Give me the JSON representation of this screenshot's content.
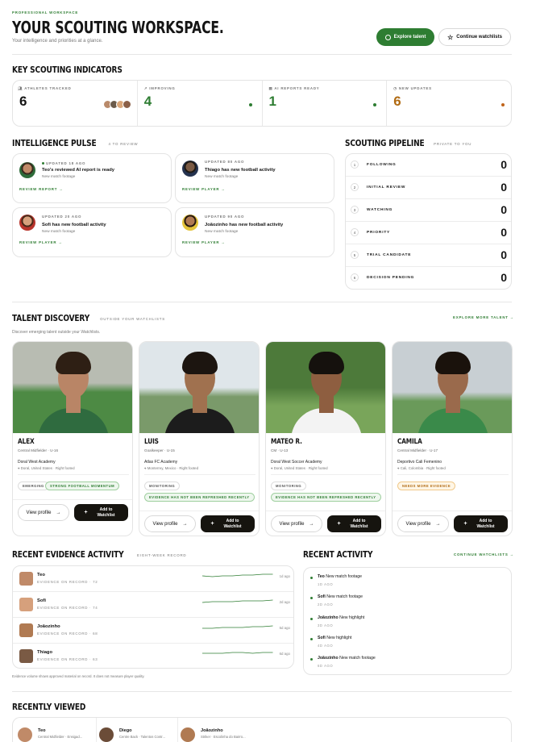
{
  "header": {
    "eyebrow": "PROFESSIONAL WORKSPACE",
    "title": "YOUR SCOUTING WORKSPACE.",
    "subtitle": "Your intelligence and priorities at a glance.",
    "explore_label": "Explore talent",
    "continue_label": "Continue watchlists"
  },
  "kpi": {
    "title": "KEY SCOUTING INDICATORS",
    "items": [
      {
        "label": "ATHLETES TRACKED",
        "value": "6"
      },
      {
        "label": "IMPROVING",
        "value": "4"
      },
      {
        "label": "AI REPORTS READY",
        "value": "1"
      },
      {
        "label": "NEW UPDATES",
        "value": "6"
      }
    ]
  },
  "pulse": {
    "title": "INTELLIGENCE PULSE",
    "badge": "4 TO REVIEW",
    "cards": [
      {
        "time": "UPDATED 18 AGO",
        "headline": "Teo's reviewed AI report is ready",
        "sub": "New match footage",
        "action": "REVIEW REPORT →"
      },
      {
        "time": "UPDATED 80 AGO",
        "headline": "Thiago has new football activity",
        "sub": "New match footage",
        "action": "REVIEW PLAYER →"
      },
      {
        "time": "UPDATED 20 AGO",
        "headline": "Sofi has new football activity",
        "sub": "New match footage",
        "action": "REVIEW PLAYER →"
      },
      {
        "time": "UPDATED 90 AGO",
        "headline": "Joãozinho has new football activity",
        "sub": "New match footage",
        "action": "REVIEW PLAYER →"
      }
    ]
  },
  "pipeline": {
    "title": "SCOUTING PIPELINE",
    "badge": "PRIVATE TO YOU",
    "stages": [
      {
        "n": "1",
        "label": "FOLLOWING",
        "count": "0"
      },
      {
        "n": "2",
        "label": "INITIAL REVIEW",
        "count": "0"
      },
      {
        "n": "3",
        "label": "WATCHING",
        "count": "0"
      },
      {
        "n": "4",
        "label": "PRIORITY",
        "count": "0"
      },
      {
        "n": "5",
        "label": "TRIAL CANDIDATE",
        "count": "0"
      },
      {
        "n": "6",
        "label": "DECISION PENDING",
        "count": "0"
      }
    ]
  },
  "discovery": {
    "title": "TALENT DISCOVERY",
    "badge": "OUTSIDE YOUR WATCHLISTS",
    "desc": "Discover emerging talent outside your Watchlists.",
    "more": "EXPLORE MORE TALENT →",
    "view_label": "View profile",
    "add_label": "Add to Watchlist",
    "players": [
      {
        "name": "ALEX",
        "role": "Central Midfielder · U-16",
        "club": "Doral West Academy",
        "loc": "Doral, United States · Right footed",
        "chips": [
          "EMERGING",
          "STRONG FOOTBALL MOMENTUM"
        ]
      },
      {
        "name": "LUIS",
        "role": "Goalkeeper · U-15",
        "club": "Atlas FC Academy",
        "loc": "Monterrey, Mexico · Right footed",
        "chips": [
          "MONITORING",
          "EVIDENCE HAS NOT BEEN REFRESHED RECENTLY"
        ]
      },
      {
        "name": "MATEO R.",
        "role": "CM · U-13",
        "club": "Doral West Soccer Academy",
        "loc": "Doral, United States · Right footed",
        "chips": [
          "MONITORING",
          "EVIDENCE HAS NOT BEEN REFRESHED RECENTLY"
        ]
      },
      {
        "name": "CAMILA",
        "role": "Central Midfielder · U-17",
        "club": "Deportivo Cali Femenino",
        "loc": "Cali, Colombia · Right footed",
        "chips": [
          "NEEDS MORE EVIDENCE"
        ]
      }
    ]
  },
  "evidence": {
    "title": "RECENT EVIDENCE ACTIVITY",
    "badge": "EIGHT-WEEK RECORD",
    "footnote": "Evidence volume shows approved material on record. It does not measure player quality.",
    "rows": [
      {
        "name": "Teo",
        "detail": "EVIDENCE ON RECORD · 72",
        "ago": "1d ago"
      },
      {
        "name": "Sofi",
        "detail": "EVIDENCE ON RECORD · 74",
        "ago": "2d ago"
      },
      {
        "name": "Joãozinho",
        "detail": "EVIDENCE ON RECORD · 68",
        "ago": "5d ago"
      },
      {
        "name": "Thiago",
        "detail": "EVIDENCE ON RECORD · 63",
        "ago": "6d ago"
      }
    ]
  },
  "activity": {
    "title": "RECENT ACTIVITY",
    "link": "CONTINUE WATCHLISTS →",
    "items": [
      {
        "name": "Teo",
        "text": "New match footage",
        "ago": "1D AGO"
      },
      {
        "name": "Sofi",
        "text": "New match footage",
        "ago": "2D AGO"
      },
      {
        "name": "Joãozinho",
        "text": "New highlight",
        "ago": "3D AGO"
      },
      {
        "name": "Sofi",
        "text": "New highlight",
        "ago": "4D AGO"
      },
      {
        "name": "Joãozinho",
        "text": "New match footage",
        "ago": "6D AGO"
      }
    ]
  },
  "recent": {
    "title": "RECENTLY VIEWED",
    "items": [
      {
        "name": "Teo",
        "role": "Central Midfielder · Ensigad..."
      },
      {
        "name": "Diego",
        "role": "Centre Back · Talentos Contr..."
      },
      {
        "name": "Joãozinho",
        "role": "Striker · Escolinha do Bairro..."
      }
    ]
  },
  "colors": {
    "brand": "#2e7d32",
    "dark": "#16140f",
    "amber": "#b06a12"
  }
}
